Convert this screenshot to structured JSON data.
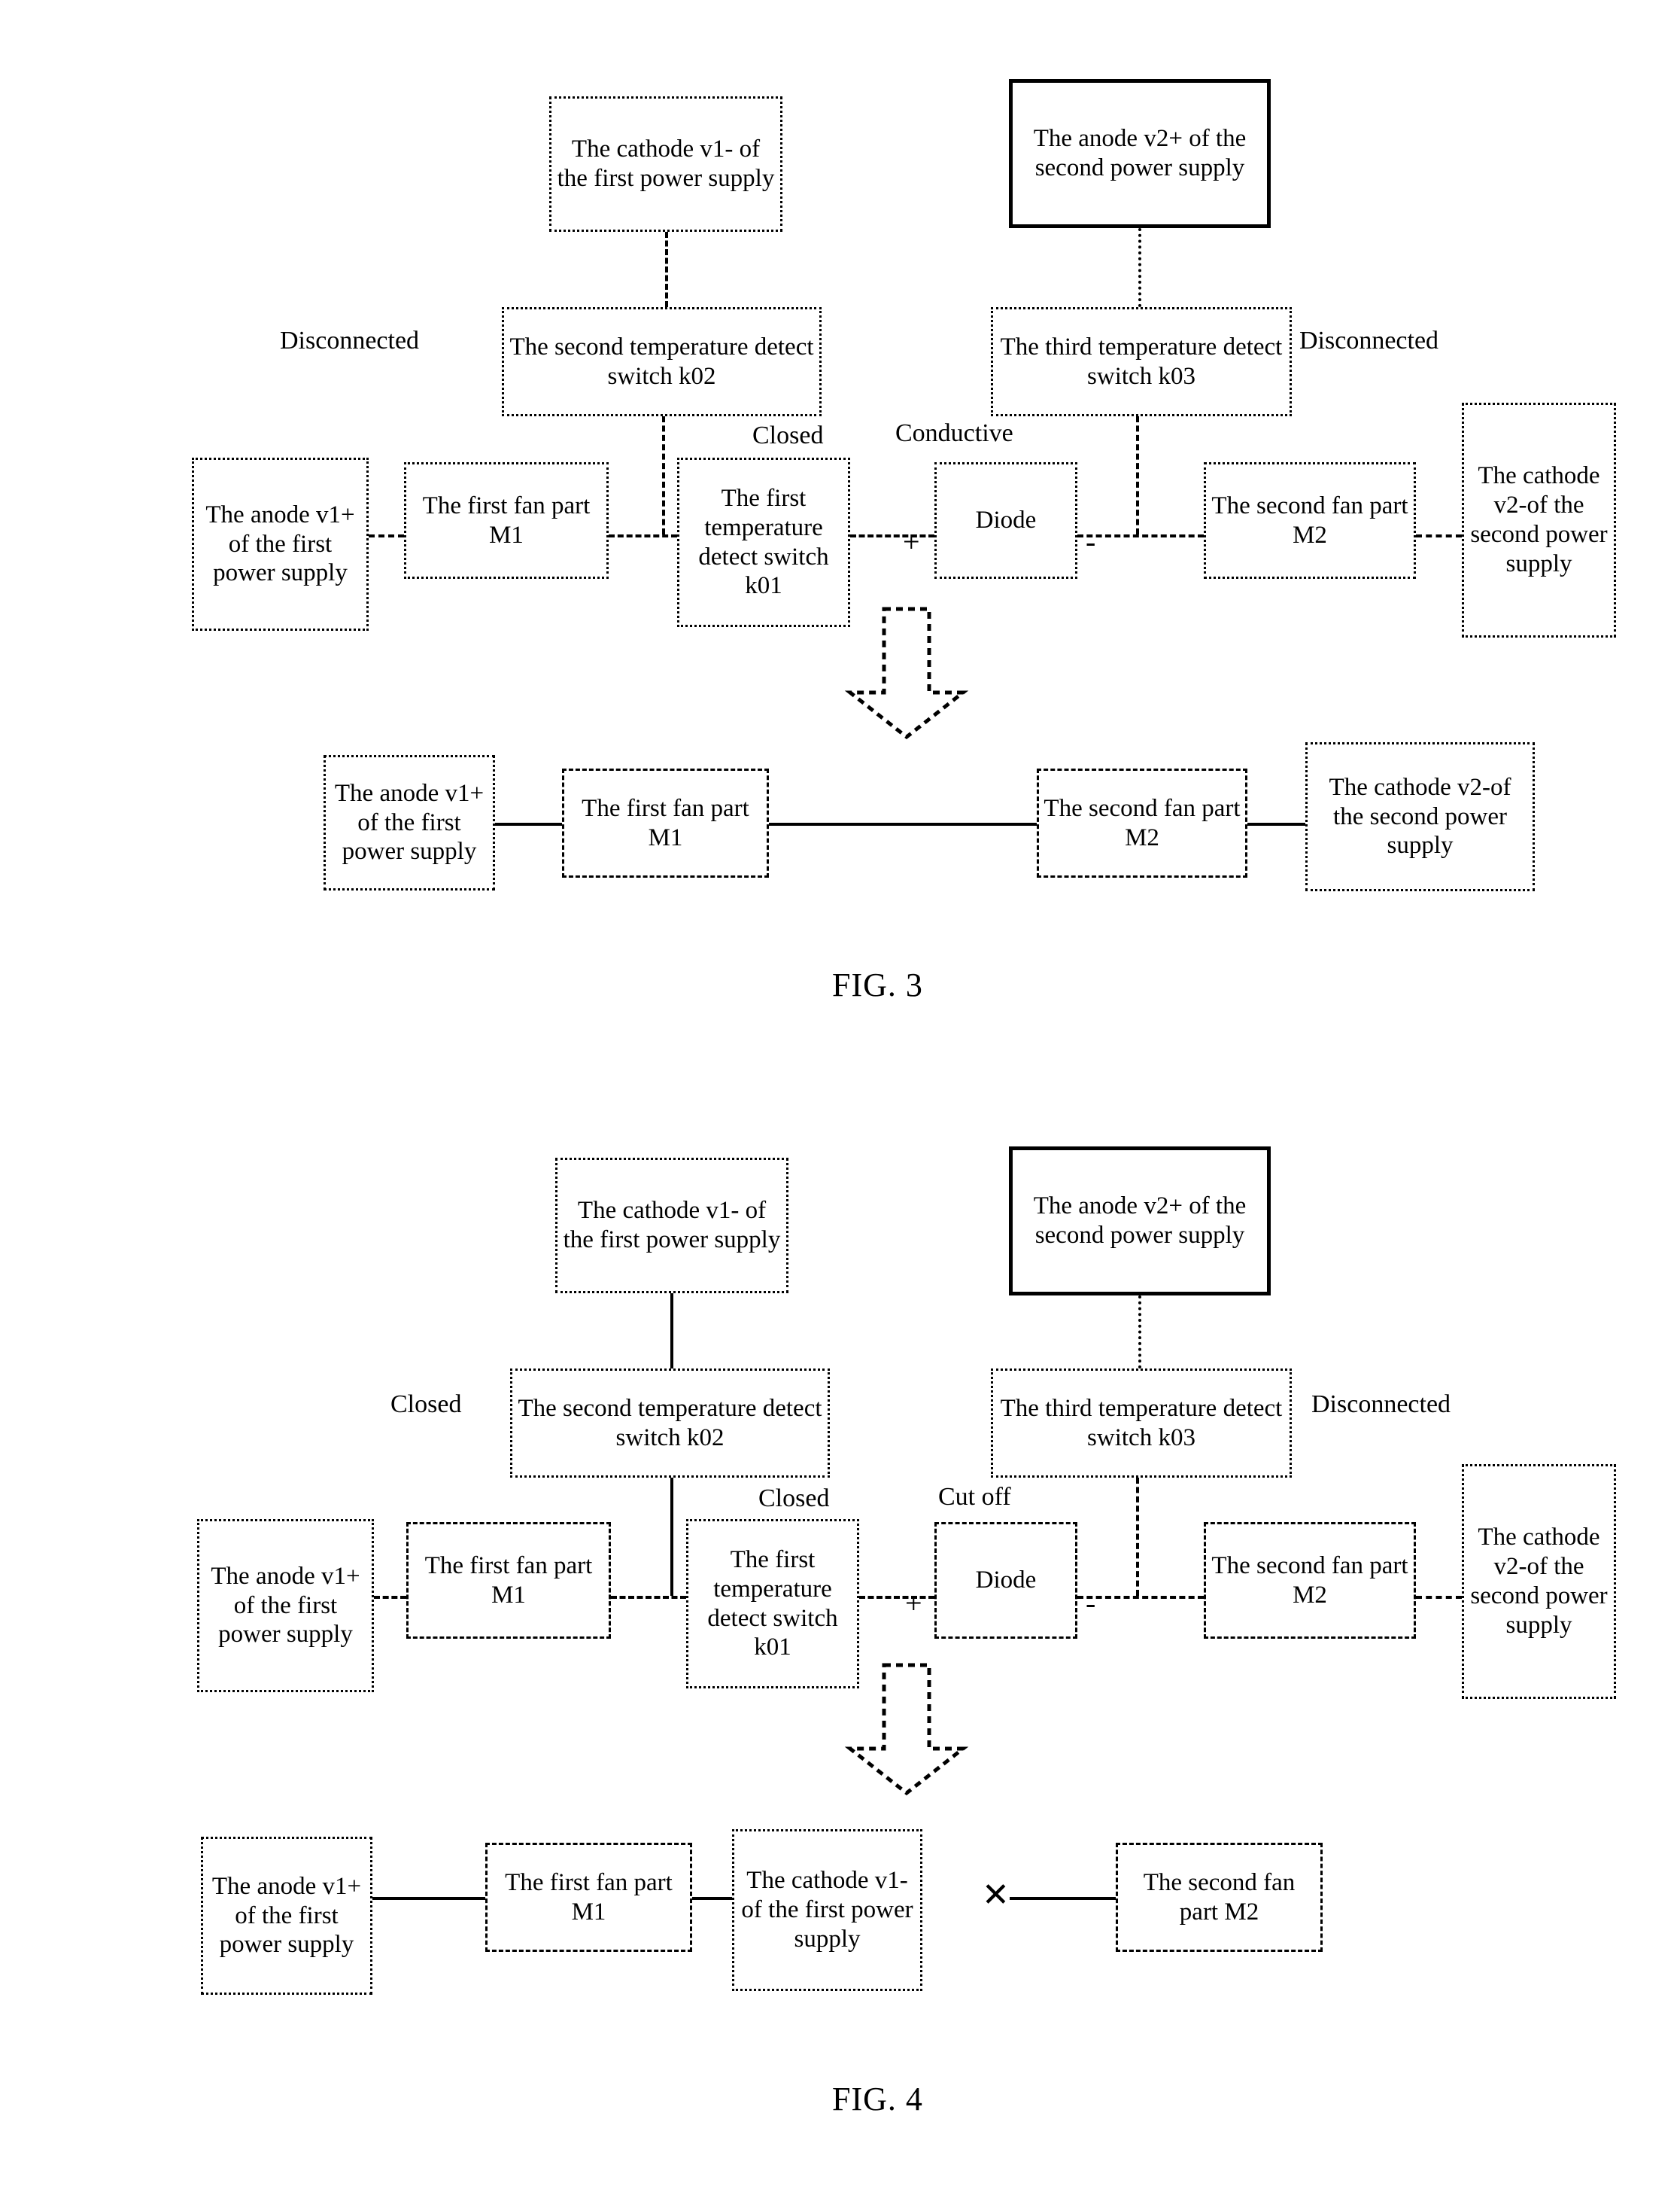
{
  "figures": [
    {
      "id": "fig3",
      "caption": "FIG. 3",
      "labels": {
        "disconnected_left": "Disconnected",
        "disconnected_right": "Disconnected",
        "closed_k01": "Closed",
        "diode_state": "Conductive",
        "plus": "+",
        "minus": "-"
      },
      "boxes": {
        "cathode_v1": "The cathode v1- of the first power supply",
        "anode_v2": "The anode v2+ of the second power supply",
        "switch_k02": "The second temperature detect switch k02",
        "switch_k03": "The third temperature detect switch k03",
        "anode_v1": "The anode v1+ of the first power supply",
        "fan_m1": "The first fan part M1",
        "switch_k01": "The first temperature detect switch k01",
        "diode": "Diode",
        "fan_m2": "The second fan part M2",
        "cathode_v2": "The cathode v2-of the second power supply"
      },
      "result_boxes": {
        "anode_v1": "The anode v1+ of the first power supply",
        "fan_m1": "The first fan part M1",
        "fan_m2": "The second fan part M2",
        "cathode_v2": "The cathode v2-of the second power supply"
      }
    },
    {
      "id": "fig4",
      "caption": "FIG. 4",
      "labels": {
        "closed_left": "Closed",
        "disconnected_right": "Disconnected",
        "closed_k01": "Closed",
        "diode_state": "Cut off",
        "plus": "+",
        "minus": "-",
        "break_mark": "✕"
      },
      "boxes": {
        "cathode_v1": "The cathode v1- of the first power supply",
        "anode_v2": "The anode v2+ of the second power supply",
        "switch_k02": "The second temperature detect switch k02",
        "switch_k03": "The third temperature detect switch k03",
        "anode_v1": "The anode v1+ of the first power supply",
        "fan_m1": "The first fan part M1",
        "switch_k01": "The first temperature detect switch k01",
        "diode": "Diode",
        "fan_m2": "The second fan part M2",
        "cathode_v2": "The cathode v2-of the second power supply"
      },
      "result_boxes": {
        "anode_v1": "The anode v1+ of the first power supply",
        "fan_m1": "The first fan part M1",
        "cathode_v1": "The cathode v1- of the first power supply",
        "fan_m2": "The second fan part M2"
      }
    }
  ]
}
